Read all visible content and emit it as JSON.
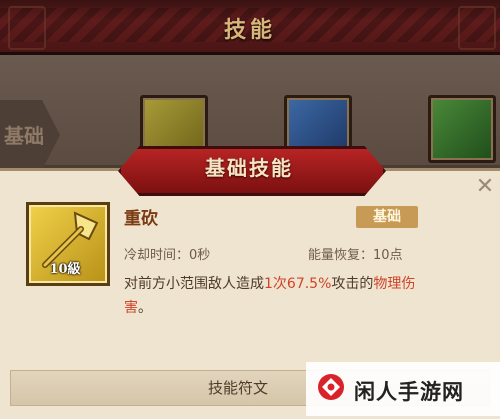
{
  "header": {
    "title": "技能"
  },
  "side_tab": {
    "label": "基础"
  },
  "panel": {
    "title": "基础技能",
    "close_symbol": "✕"
  },
  "skill": {
    "name": "重砍",
    "level": "10級",
    "tag": "基础",
    "cooldown": "冷却时间：0秒",
    "energy": "能量恢复：10点",
    "desc_parts": {
      "p1": "对前方小范围敌人造成",
      "p2": "1次",
      "p3": "67.5%",
      "p4": "攻击的",
      "p5": "物理伤害",
      "p6": "。"
    }
  },
  "bottom": {
    "label": "技能符文"
  },
  "watermark": {
    "text": "闲人手游网"
  },
  "colors": {
    "accent_red": "#b72424",
    "highlight": "#d0442a",
    "panel_bg": "#efe4cf"
  },
  "icons": [
    "axe-icon",
    "close-icon",
    "watermark-logo"
  ]
}
